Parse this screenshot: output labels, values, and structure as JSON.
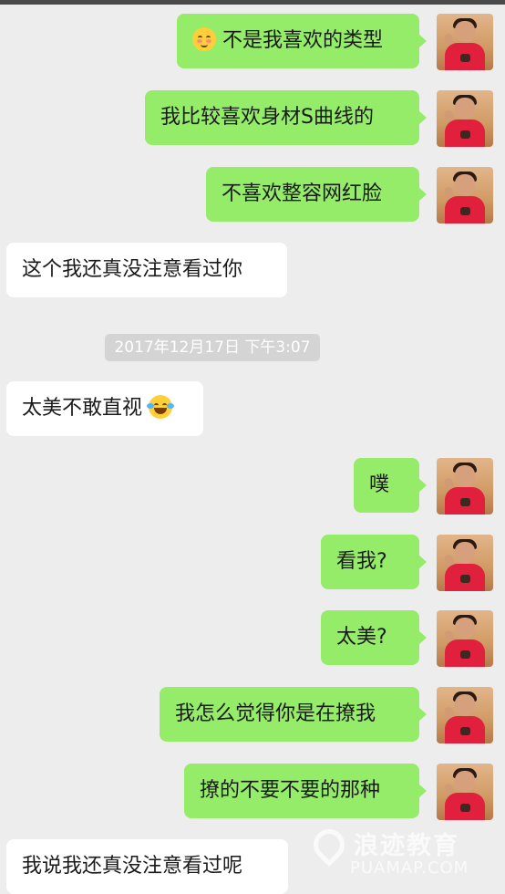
{
  "messages": [
    {
      "side": "right",
      "emoji": "blush",
      "text": "不是我喜欢的类型"
    },
    {
      "side": "right",
      "text": "我比较喜欢身材S曲线的"
    },
    {
      "side": "right",
      "text": "不喜欢整容网红脸"
    },
    {
      "side": "left",
      "text": "这个我还真没注意看过你"
    },
    {
      "timestamp": "2017年12月17日 下午3:07"
    },
    {
      "side": "left",
      "text": "太美不敢直视",
      "emoji_after": "laugh-tears"
    },
    {
      "side": "right",
      "text": "噗"
    },
    {
      "side": "right",
      "text": "看我?"
    },
    {
      "side": "right",
      "text": "太美?"
    },
    {
      "side": "right",
      "text": "我怎么觉得你是在撩我"
    },
    {
      "side": "right",
      "text": "撩的不要不要的那种"
    },
    {
      "side": "left",
      "text": "我说我还真没注意看过呢"
    }
  ],
  "watermark": {
    "cn": "浪迹教育",
    "en": "PUAMAP.COM"
  },
  "colors": {
    "bubble_right": "#95ec69",
    "bubble_left": "#ffffff",
    "background": "#ededed"
  },
  "icons": {
    "avatar": "avatar-man-red-shirt",
    "emoji_blush": "smiling-face-with-blush",
    "emoji_laugh": "face-with-tears-of-joy",
    "watermark_pin": "location-pin-icon"
  }
}
